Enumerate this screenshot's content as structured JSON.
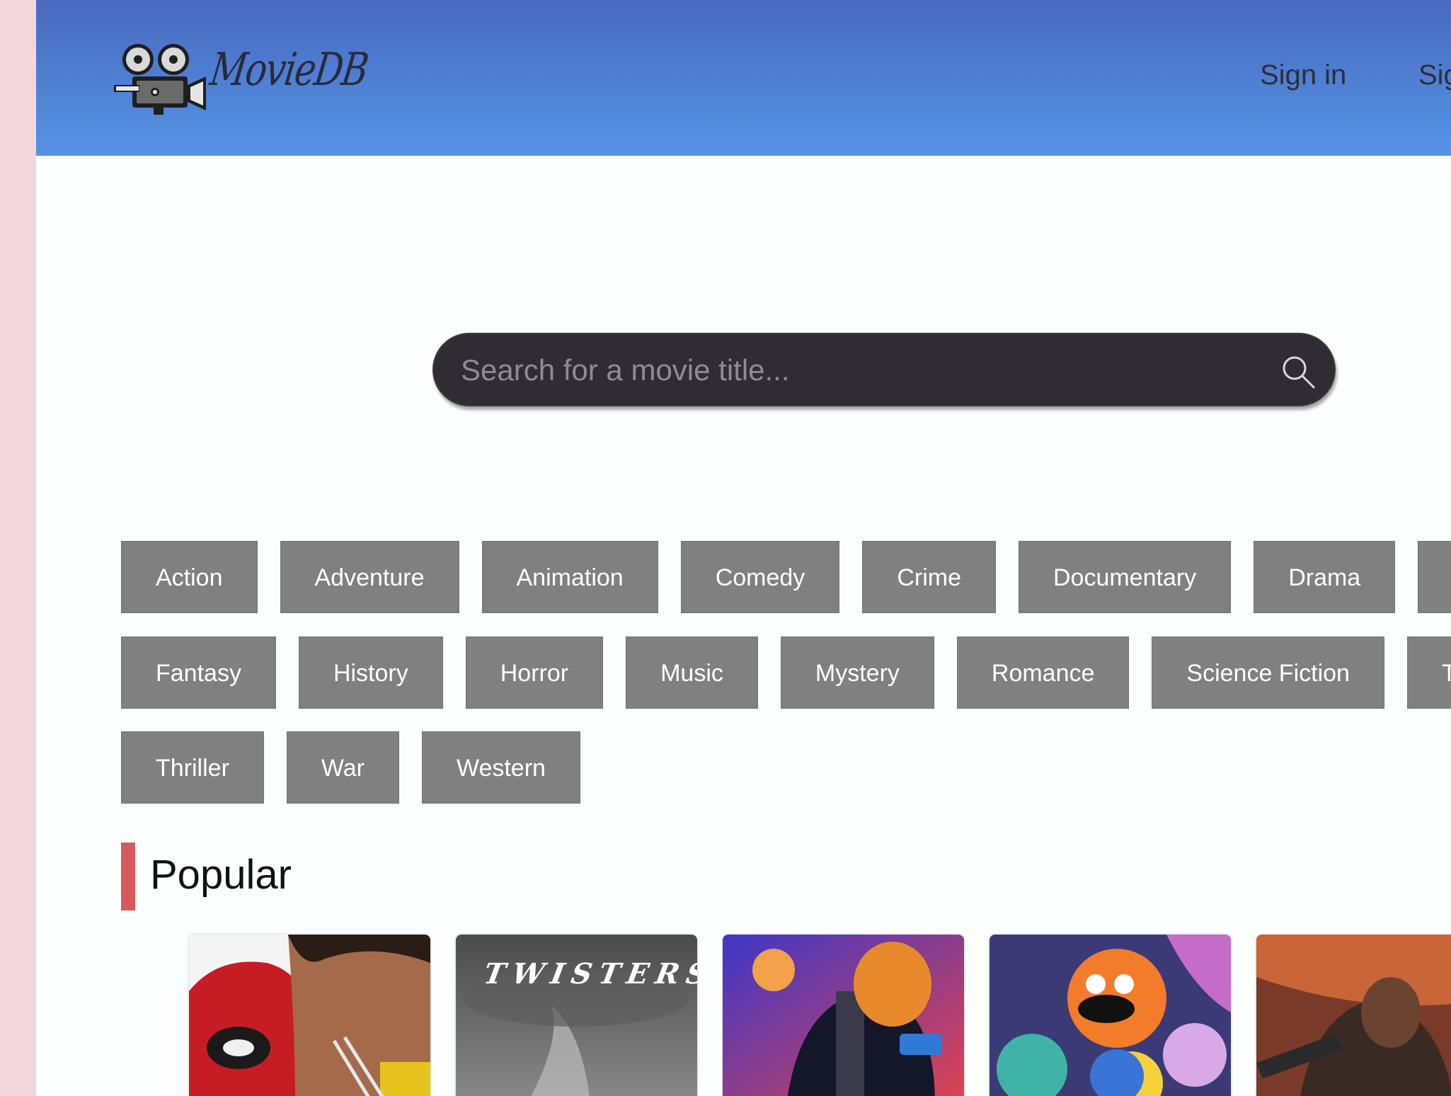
{
  "app": {
    "logo_text": "MovieDB"
  },
  "nav": {
    "sign_in": "Sign in",
    "sign_up": "Sig"
  },
  "search": {
    "placeholder": "Search for a movie title...",
    "value": ""
  },
  "genres": {
    "row1": [
      "Action",
      "Adventure",
      "Animation",
      "Comedy",
      "Crime",
      "Documentary",
      "Drama",
      ""
    ],
    "row2": [
      "Fantasy",
      "History",
      "Horror",
      "Music",
      "Mystery",
      "Romance",
      "Science Fiction",
      "TV"
    ],
    "row3": [
      "Thriller",
      "War",
      "Western"
    ]
  },
  "popular": {
    "title": "Popular",
    "posters": [
      {
        "title_text": ""
      },
      {
        "title_text": "TWISTERS"
      },
      {
        "title_text": ""
      },
      {
        "title_text": ""
      },
      {
        "title_text": ""
      }
    ]
  },
  "colors": {
    "header_top": "#4a6ac0",
    "header_bottom": "#5593e4",
    "genre_bg": "#808080",
    "search_bg": "#302c33",
    "section_accent": "#d65a5c",
    "side_margin": "#f1d7db"
  },
  "icons": [
    "film-camera-logo-icon",
    "search-icon"
  ]
}
